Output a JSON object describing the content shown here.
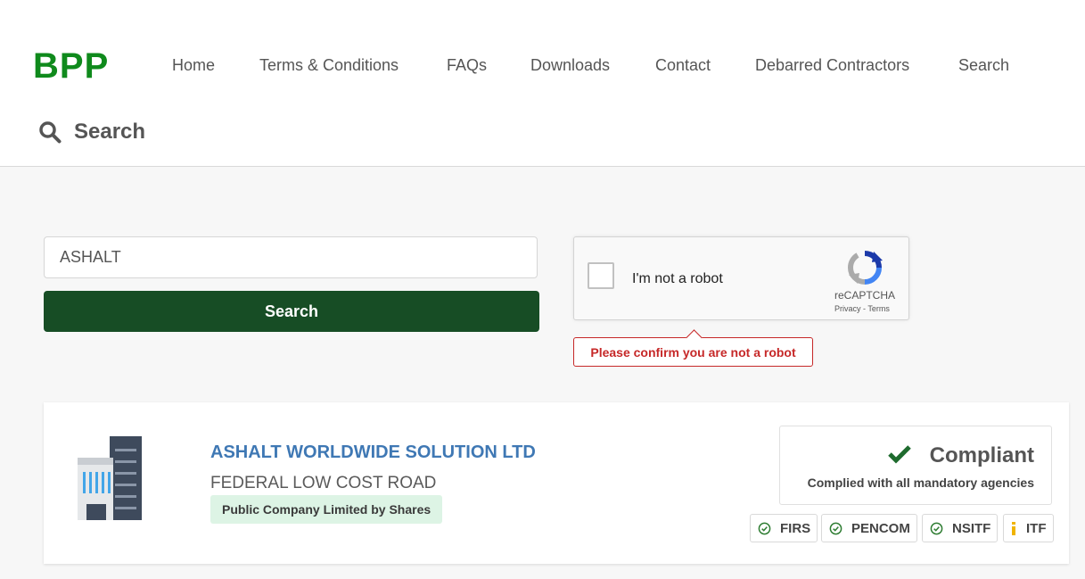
{
  "brand": {
    "logo_text": "BPP",
    "color": "#0f8a1c"
  },
  "nav": {
    "items": [
      {
        "label": "Home"
      },
      {
        "label": "Terms & Conditions"
      },
      {
        "label": "FAQs"
      },
      {
        "label": "Downloads"
      },
      {
        "label": "Contact"
      },
      {
        "label": "Debarred Contractors"
      },
      {
        "label": "Search"
      }
    ]
  },
  "page": {
    "title": "Search",
    "icon": "search-icon"
  },
  "search": {
    "value": "ASHALT",
    "button_label": "Search",
    "button_color": "#174d25"
  },
  "captcha": {
    "checkbox_label": "I'm not a robot",
    "brand": "reCAPTCHA",
    "links": "Privacy - Terms",
    "error": "Please confirm you are not a robot",
    "error_color": "#c62828"
  },
  "result": {
    "name": "ASHALT WORLDWIDE SOLUTION LTD",
    "address": "FEDERAL LOW COST ROAD",
    "company_type": "Public Company Limited by Shares",
    "icon": "building-icon",
    "status": {
      "title": "Compliant",
      "description": "Complied with all mandatory agencies",
      "icon": "checkmark-icon",
      "color": "#1e6b2e"
    },
    "agencies": [
      {
        "label": "FIRS",
        "icon": "check-circle-icon"
      },
      {
        "label": "PENCOM",
        "icon": "check-circle-icon"
      },
      {
        "label": "NSITF",
        "icon": "check-circle-icon"
      },
      {
        "label": "ITF",
        "icon": "info-icon"
      }
    ]
  }
}
